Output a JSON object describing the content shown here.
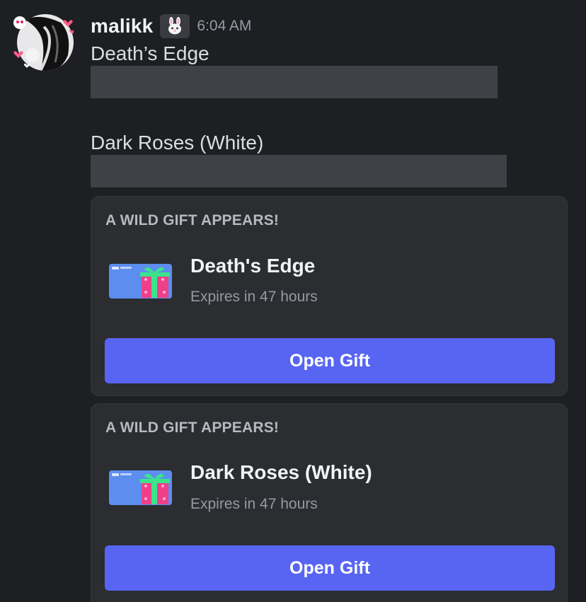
{
  "message": {
    "username": "malikk",
    "role_icon": "bunny-icon",
    "timestamp": "6:04 AM",
    "lines": [
      "Death’s Edge",
      "Dark Roses (White)"
    ]
  },
  "gifts": [
    {
      "heading": "A WILD GIFT APPEARS!",
      "thumbnail_icon": "gift-card-icon",
      "title": "Death's Edge",
      "expiry": "Expires in 47 hours",
      "button_label": "Open Gift"
    },
    {
      "heading": "A WILD GIFT APPEARS!",
      "thumbnail_icon": "gift-card-icon",
      "title": "Dark Roses (White)",
      "expiry": "Expires in 47 hours",
      "button_label": "Open Gift"
    }
  ],
  "colors": {
    "background": "#1e1f22",
    "card": "#2b2d31",
    "button": "#5865f2",
    "redaction": "#3f4147"
  }
}
